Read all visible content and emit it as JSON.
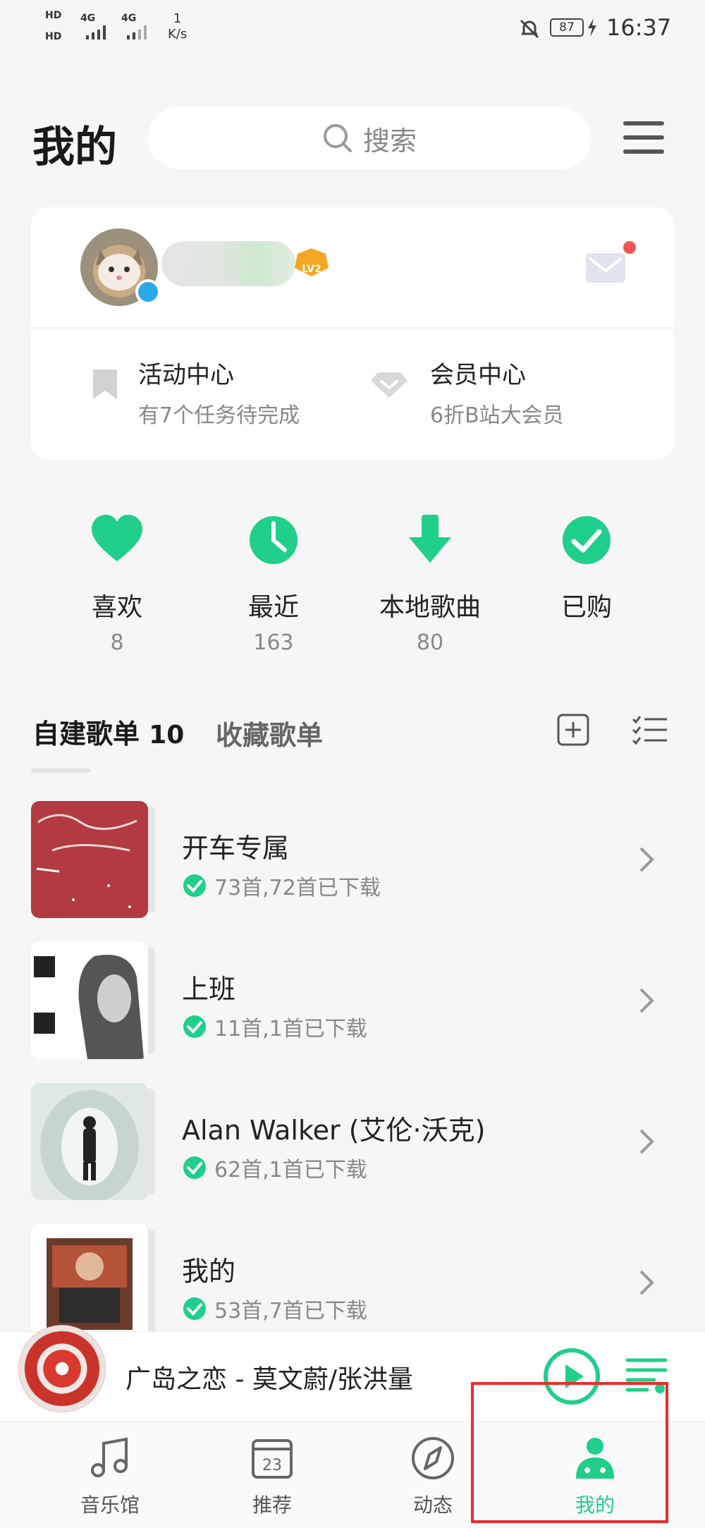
{
  "status_bar": {
    "network_1": "4G",
    "network_2": "4G",
    "speed_value": "1",
    "speed_unit": "K/s",
    "battery": "87",
    "time": "16:37"
  },
  "header": {
    "title": "我的",
    "search_placeholder": "搜索"
  },
  "profile": {
    "level": "LV2",
    "activity": {
      "title": "活动中心",
      "subtitle": "有7个任务待完成"
    },
    "vip": {
      "title": "会员中心",
      "subtitle": "6折B站大会员"
    }
  },
  "quick_entries": [
    {
      "label": "喜欢",
      "count": "8",
      "icon": "heart-icon"
    },
    {
      "label": "最近",
      "count": "163",
      "icon": "clock-icon"
    },
    {
      "label": "本地歌曲",
      "count": "80",
      "icon": "download-icon"
    },
    {
      "label": "已购",
      "count": "",
      "icon": "check-circle-icon"
    }
  ],
  "playlist_tabs": {
    "self_label": "自建歌单",
    "self_count": "10",
    "fav_label": "收藏歌单"
  },
  "playlists": [
    {
      "title": "开车专属",
      "subtitle": "73首,72首已下载"
    },
    {
      "title": "上班",
      "subtitle": "11首,1首已下载"
    },
    {
      "title": "Alan Walker (艾伦·沃克)",
      "subtitle": "62首,1首已下载"
    },
    {
      "title": "我的",
      "subtitle": "53首,7首已下载"
    }
  ],
  "now_playing": {
    "text": "广岛之恋 - 莫文蔚/张洪量"
  },
  "bottom_nav": [
    {
      "label": "音乐馆",
      "icon": "music-note-icon"
    },
    {
      "label": "推荐",
      "icon": "calendar-icon",
      "badge": "23"
    },
    {
      "label": "动态",
      "icon": "compass-icon"
    },
    {
      "label": "我的",
      "icon": "profile-icon",
      "active": true
    }
  ],
  "colors": {
    "accent": "#1fcf8a",
    "highlight": "#f02a2a"
  }
}
